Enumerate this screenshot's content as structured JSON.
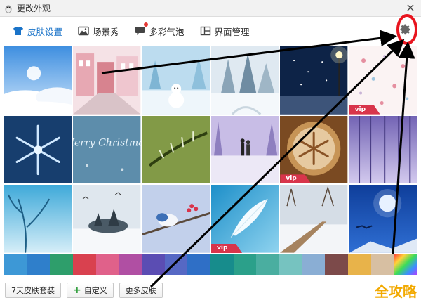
{
  "window": {
    "title": "更改外观",
    "close_label": "×"
  },
  "tabs": [
    {
      "label": "皮肤设置",
      "active": true
    },
    {
      "label": "场景秀",
      "active": false
    },
    {
      "label": "多彩气泡",
      "active": false,
      "badge": true
    },
    {
      "label": "界面管理",
      "active": false
    }
  ],
  "skins": [
    {
      "name": "clouds-sky",
      "vip": false
    },
    {
      "name": "pink-street",
      "vip": false
    },
    {
      "name": "snowman-field",
      "vip": false
    },
    {
      "name": "snowy-forest",
      "vip": false
    },
    {
      "name": "night-streetlamp",
      "vip": false
    },
    {
      "name": "pink-snowflakes",
      "vip": true,
      "vip_label": "vip"
    },
    {
      "name": "ice-snowflake",
      "vip": false
    },
    {
      "name": "merry-christmas-glass",
      "vip": false,
      "text": "Merry Christmas"
    },
    {
      "name": "frosted-pine",
      "vip": false
    },
    {
      "name": "couple-snow-path",
      "vip": false
    },
    {
      "name": "latte-snowflake",
      "vip": true,
      "vip_label": "vip"
    },
    {
      "name": "purple-trees",
      "vip": false
    },
    {
      "name": "blue-branches",
      "vip": false
    },
    {
      "name": "snowy-shore-birds",
      "vip": false
    },
    {
      "name": "bird-on-branch",
      "vip": false
    },
    {
      "name": "white-feather",
      "vip": true,
      "vip_label": "vip"
    },
    {
      "name": "snowy-bridge",
      "vip": false
    },
    {
      "name": "moon-reindeer",
      "vip": false
    }
  ],
  "colors": [
    "#3d98d6",
    "#2f7fcb",
    "#2e9e6b",
    "#d9414f",
    "#e0618a",
    "#b04fa3",
    "#5b4db3",
    "#5668c4",
    "#2f6fc6",
    "#178c8c",
    "#2ba08a",
    "#4aaea0",
    "#76c3c0",
    "#8aaed4",
    "#7c4a4a",
    "#e8b34a",
    "#d7bfa2",
    "rainbow"
  ],
  "bottom": {
    "pack_label": "7天皮肤套装",
    "custom_label": "自定义",
    "more_label": "更多皮肤"
  },
  "watermark": "全攻略"
}
